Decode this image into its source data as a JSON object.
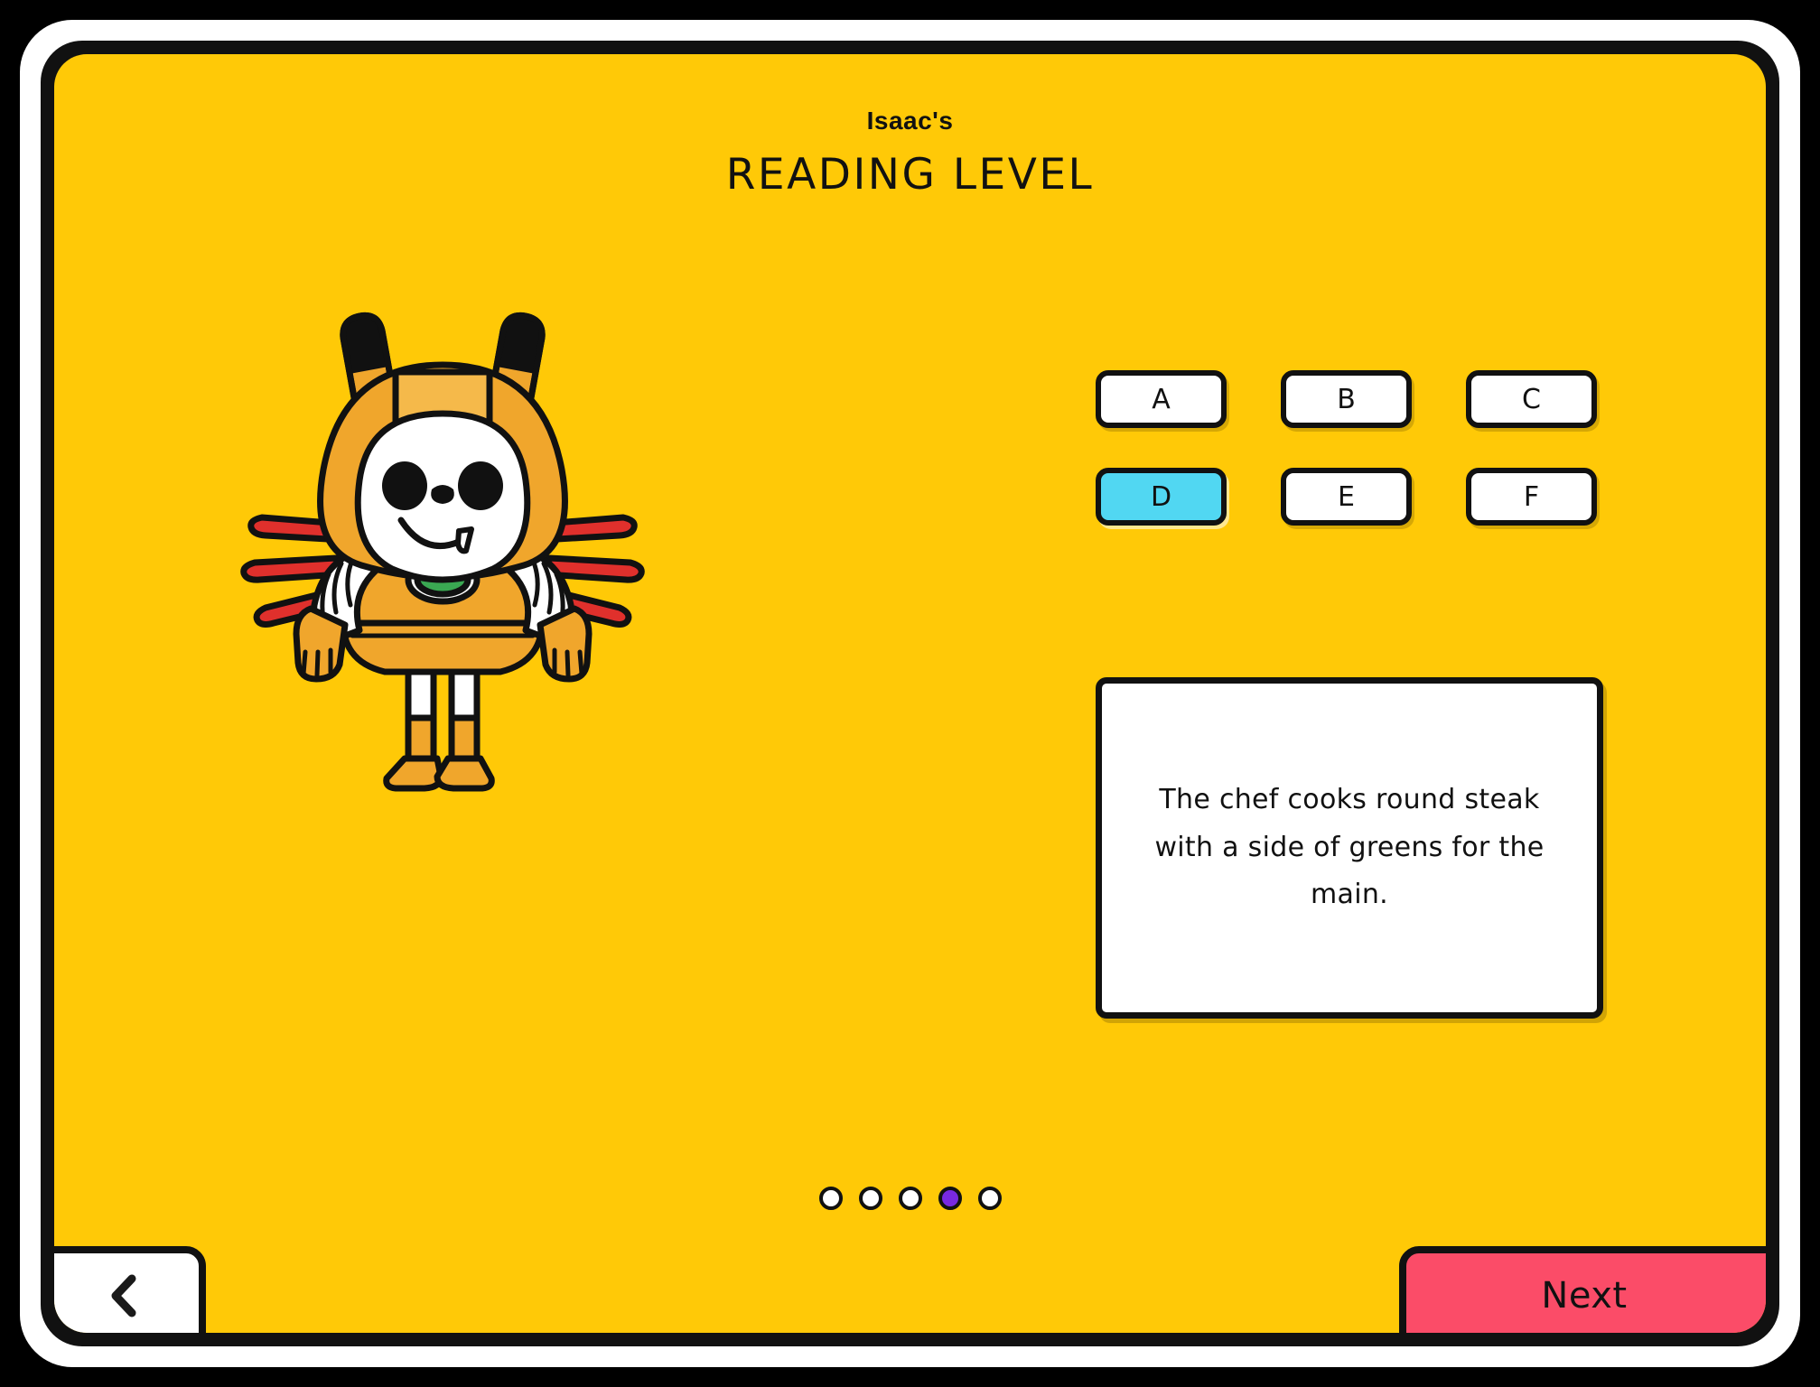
{
  "header": {
    "owner": "Isaac's",
    "title": "READING LEVEL"
  },
  "levels": {
    "options": [
      {
        "label": "A",
        "selected": false
      },
      {
        "label": "B",
        "selected": false
      },
      {
        "label": "C",
        "selected": false
      },
      {
        "label": "D",
        "selected": true
      },
      {
        "label": "E",
        "selected": false
      },
      {
        "label": "F",
        "selected": false
      }
    ],
    "selected_value": "D"
  },
  "passage": {
    "text": "The chef cooks round steak with a side of greens for the main."
  },
  "pagination": {
    "total": 5,
    "current": 4,
    "dots": [
      {
        "active": false
      },
      {
        "active": false
      },
      {
        "active": false
      },
      {
        "active": true
      },
      {
        "active": false
      }
    ]
  },
  "nav": {
    "back_icon": "chevron-left-icon",
    "next_label": "Next"
  },
  "avatar": {
    "name": "astronaut-character",
    "hood_color": "#F0A62C",
    "hood_highlight": "#F5B94A",
    "face_color": "#FFFFFF",
    "spike_color": "#E0302C",
    "ear_tip_color": "#111111",
    "badge_color": "#3AA852",
    "outline_color": "#111111"
  },
  "colors": {
    "screen_background": "#FFC907",
    "selected_level": "#51D7F2",
    "next_button": "#FB4C68",
    "active_dot": "#7829E2",
    "outline": "#111111",
    "panel_background": "#FFFFFF"
  }
}
